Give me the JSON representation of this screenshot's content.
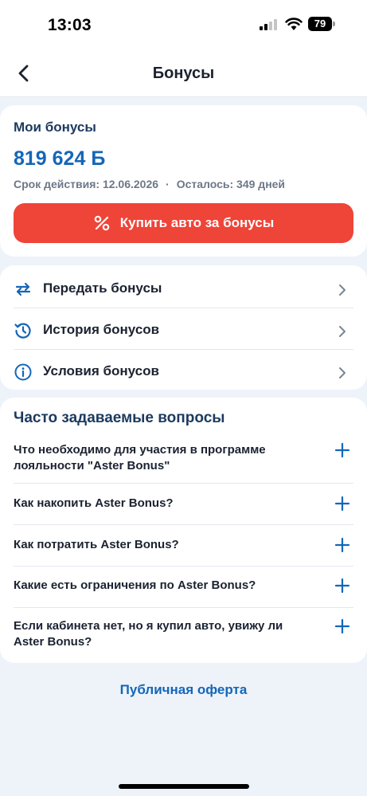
{
  "status_bar": {
    "time": "13:03",
    "battery": "79"
  },
  "header": {
    "title": "Бонусы"
  },
  "bonus_card": {
    "title": "Мои бонусы",
    "amount": "819 624 Б",
    "expiry": "Срок действия: 12.06.2026",
    "separator": "·",
    "remaining": "Осталось: 349 дней",
    "buy_button": "Купить авто за бонусы"
  },
  "menu": {
    "items": [
      {
        "label": "Передать бонусы",
        "icon": "transfer-arrows-icon"
      },
      {
        "label": "История бонусов",
        "icon": "history-clock-icon"
      },
      {
        "label": "Условия бонусов",
        "icon": "info-circle-icon"
      }
    ]
  },
  "faq": {
    "title": "Часто задаваемые вопросы",
    "items": [
      {
        "question": "Что необходимо для участия в программе лояльности \"Aster Bonus\""
      },
      {
        "question": "Как накопить Aster Bonus?"
      },
      {
        "question": "Как потратить Aster Bonus?"
      },
      {
        "question": "Какие есть ограничения по Aster Bonus?"
      },
      {
        "question": "Если кабинета нет, но я купил авто, увижу ли Aster Bonus?"
      }
    ]
  },
  "public_offer": "Публичная оферта",
  "colors": {
    "accent_blue": "#1466b8",
    "button_red": "#ef4438",
    "background": "#eef3fa",
    "title_navy": "#1c3a5e"
  }
}
